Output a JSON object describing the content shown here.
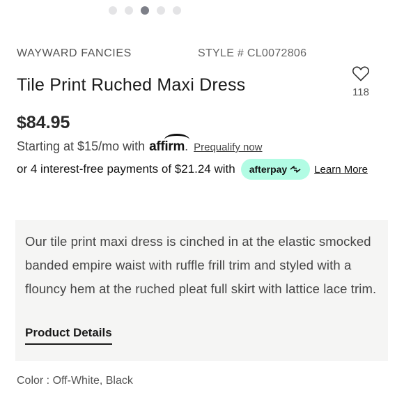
{
  "carousel": {
    "count": 5,
    "active_index": 2
  },
  "product": {
    "brand": "WAYWARD FANCIES",
    "style": "STYLE # CL0072806",
    "title": "Tile Print Ruched Maxi Dress",
    "favorites_count": "118",
    "price": "$84.95"
  },
  "affirm": {
    "text": "Starting at $15/mo with",
    "logo": "affirm",
    "period": ".",
    "prequalify_label": "Prequalify now"
  },
  "afterpay": {
    "text": "or 4 interest-free payments of $21.24 with",
    "logo": "afterpay",
    "learn_more_label": "Learn More"
  },
  "description": {
    "text": "Our tile print maxi dress is cinched in at the elastic smocked banded empire waist with ruffle frill trim and styled with a flouncy hem at the ruched pleat full skirt with lattice lace trim.",
    "details_label": "Product Details"
  },
  "color": {
    "text": "Color : Off-White, Black"
  },
  "colors": {
    "afterpay_badge": "#b2fce4",
    "active_dot": "#7d7f88",
    "desc_bg": "#f5f5f4"
  }
}
